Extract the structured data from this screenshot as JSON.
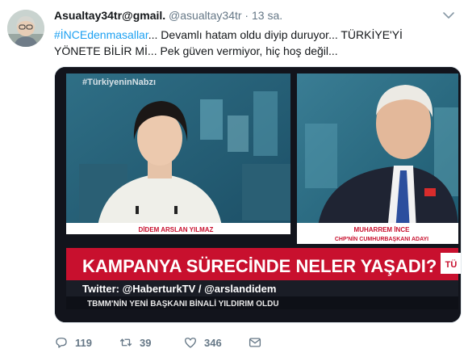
{
  "tweet": {
    "display_name": "Asualtay34tr@gmail.",
    "handle": "@asualtay34tr",
    "separator": "·",
    "time": "13 sa.",
    "hashtag": "#İNCEdenmasallar",
    "text": "... Devamlı hatam oldu diyip duruyor... TÜRKİYE'Yİ YÖNETE BİLİR Mİ... Pek güven vermiyor, hiç hoş değil...",
    "media": {
      "corner_tag": "#TürkiyeninNabzı",
      "left_name": "DİDEM ARSLAN YILMAZ",
      "right_name": "MUHARREM İNCE",
      "right_title": "CHP'NİN CUMHURBAŞKANI ADAYI",
      "headline": "KAMPANYA SÜRECİNDE NELER YAŞADI?",
      "headline_corner": "TÜ",
      "social": "Twitter: @HaberturkTV / @arslandidem",
      "ticker": "TBMM'NİN YENİ BAŞKANI BİNALİ YILDIRIM OLDU"
    },
    "actions": {
      "replies": "119",
      "retweets": "39",
      "likes": "346"
    }
  },
  "colors": {
    "link": "#1da1f2",
    "muted": "#657786",
    "text": "#14171a",
    "headline_red": "#c8102e"
  }
}
